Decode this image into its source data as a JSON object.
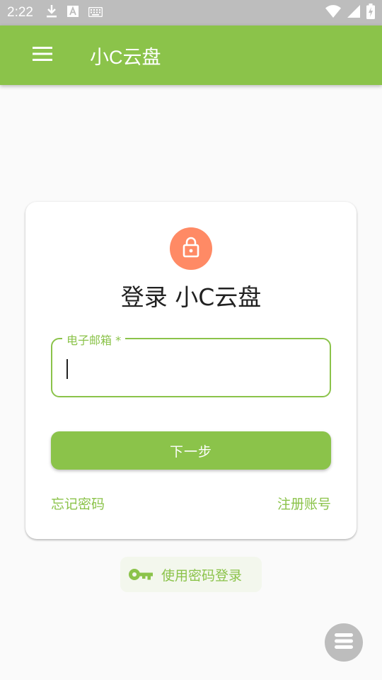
{
  "status_bar": {
    "time": "2:22",
    "icons": [
      "download-icon",
      "text-a-icon",
      "keyboard-icon",
      "wifi-icon",
      "signal-icon",
      "battery-charging-icon"
    ]
  },
  "app_bar": {
    "menu_icon": "hamburger-menu-icon",
    "title": "小C云盘"
  },
  "login_card": {
    "icon": "lock-icon",
    "title": "登录 小C云盘",
    "email_field": {
      "label": "电子邮箱 *",
      "value": ""
    },
    "next_button": "下一步",
    "forgot_password": "忘记密码",
    "register": "注册账号"
  },
  "password_login_button": {
    "icon": "key-icon",
    "label": "使用密码登录"
  },
  "fab": {
    "icon": "stacked-menu-icon"
  },
  "colors": {
    "primary": "#8bc34a",
    "avatar": "#ff8a65",
    "status_bar": "#bdbdbd",
    "fab": "#bdbdbd"
  }
}
